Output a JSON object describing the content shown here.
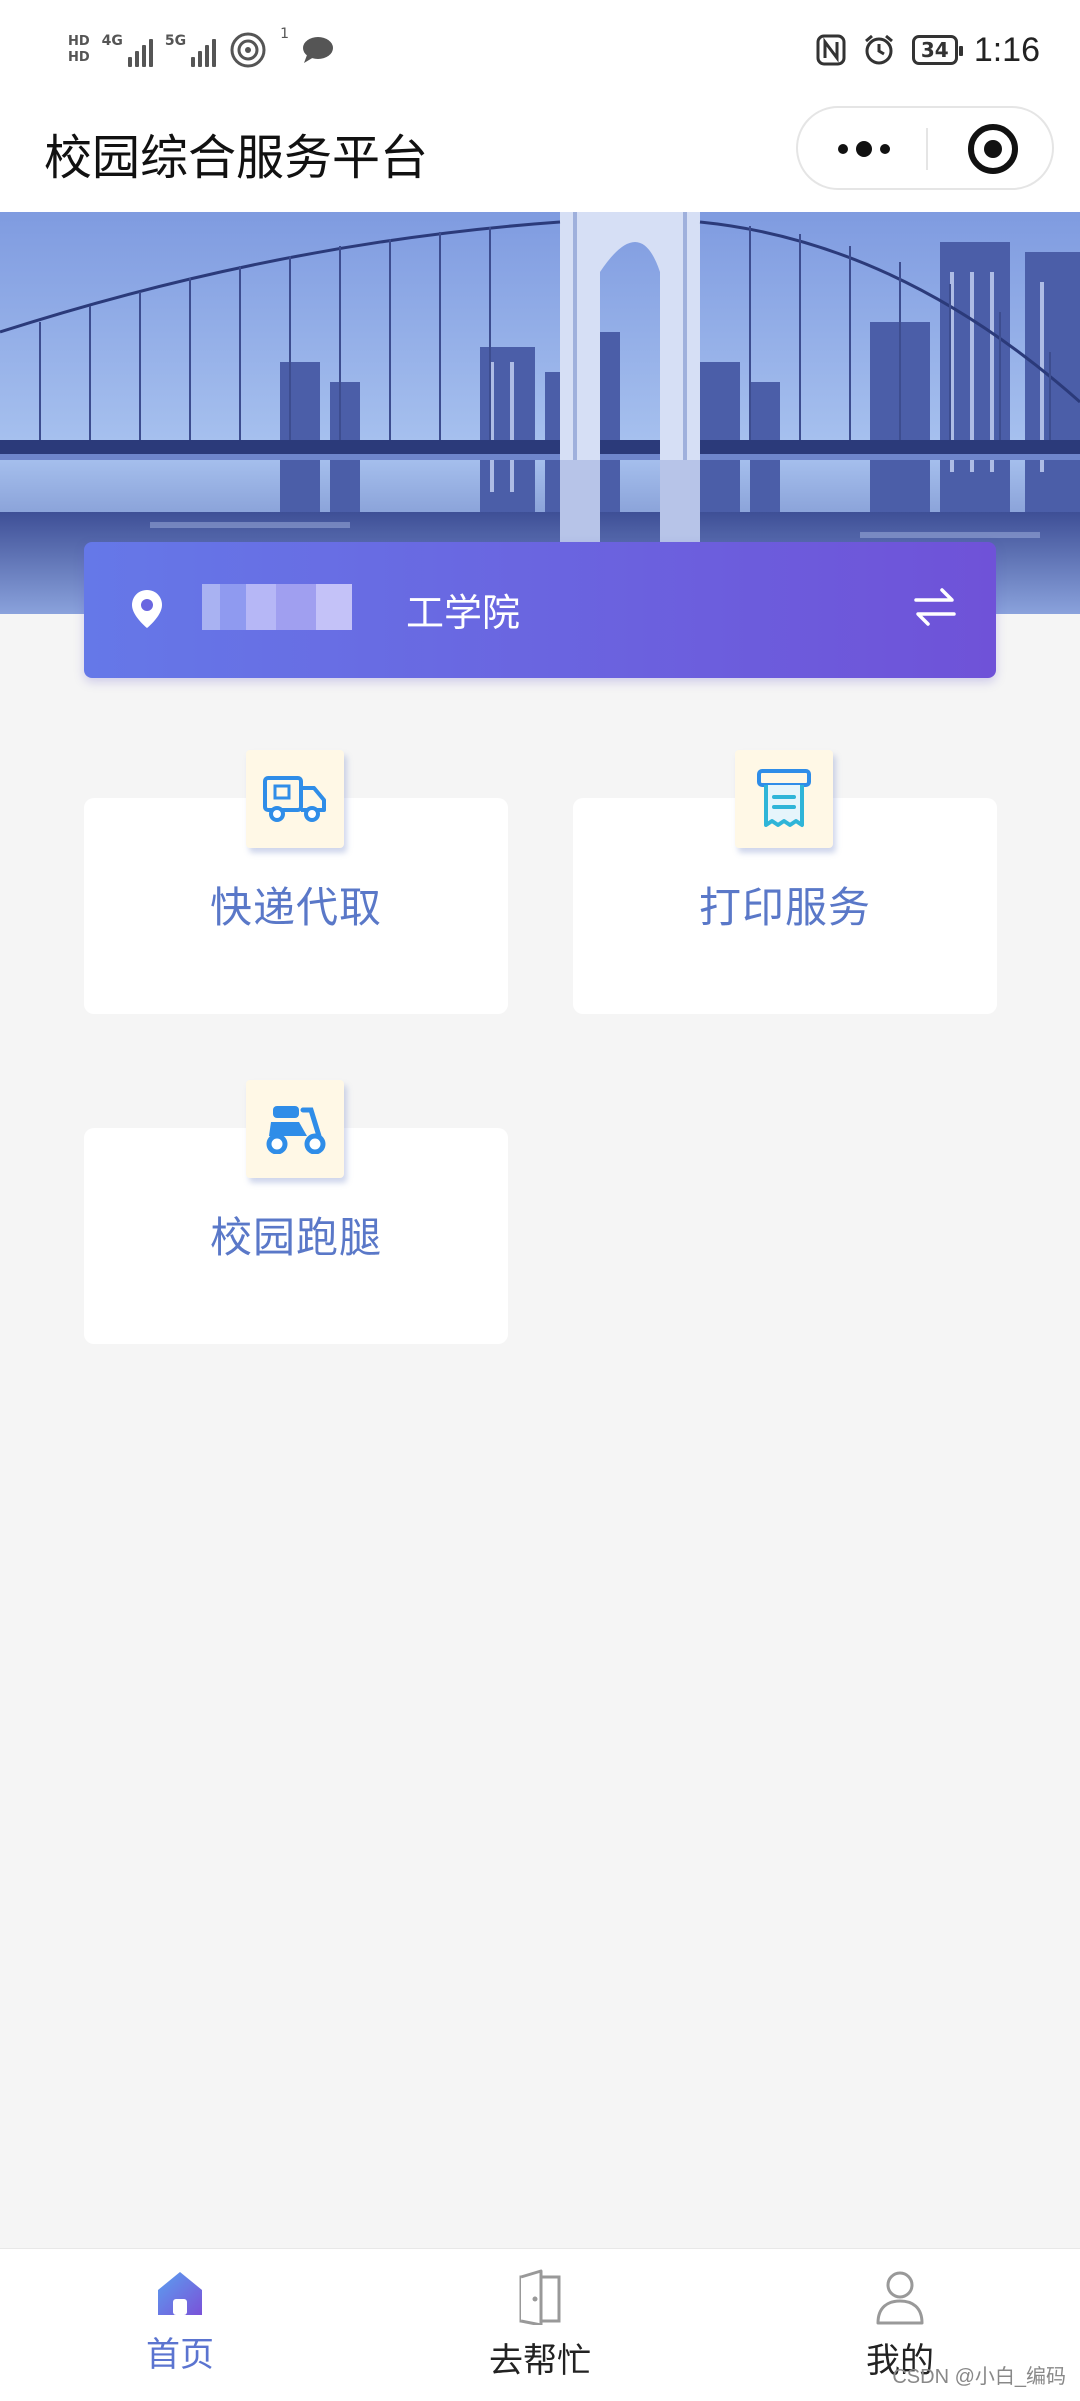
{
  "status_bar": {
    "hd1": "HD",
    "hd2": "HD",
    "net1": "4G",
    "net2": "5G",
    "notification_count": "1",
    "battery": "34",
    "time": "1:16"
  },
  "nav": {
    "title": "校园综合服务平台"
  },
  "school": {
    "name": "工学院"
  },
  "services": [
    {
      "label": "快递代取",
      "icon": "delivery-truck-icon"
    },
    {
      "label": "打印服务",
      "icon": "printer-icon"
    },
    {
      "label": "校园跑腿",
      "icon": "scooter-icon"
    }
  ],
  "tabbar": {
    "items": [
      {
        "label": "首页",
        "icon": "home-icon",
        "active": true
      },
      {
        "label": "去帮忙",
        "icon": "door-icon",
        "active": false
      },
      {
        "label": "我的",
        "icon": "user-icon",
        "active": false
      }
    ]
  },
  "watermark": "CSDN @小白_编码",
  "colors": {
    "accent": "#5b74d0",
    "card_gradient_start": "#6578e8",
    "card_gradient_end": "#6f52d8",
    "icon_bg": "#fff8e6",
    "icon_blue": "#2f8de8"
  }
}
